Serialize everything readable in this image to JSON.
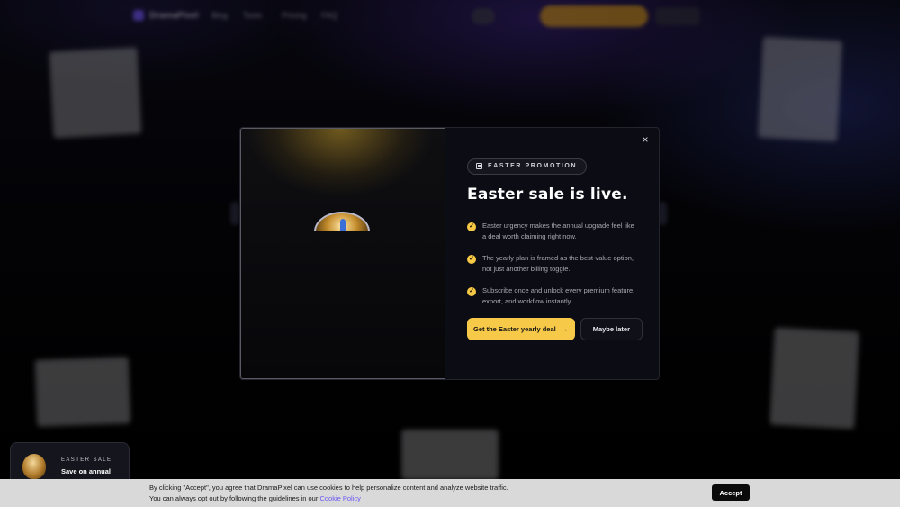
{
  "navbar": {
    "logo_text": "DramaPixel",
    "links": [
      "Blog",
      "Tools",
      "Pricing",
      "FAQ"
    ]
  },
  "modal": {
    "badge": "EASTER PROMOTION",
    "headline": "Easter sale is live.",
    "features": [
      "Easter urgency makes the annual upgrade feel like a deal worth claiming right now.",
      "The yearly plan is framed as the best-value option, not just another billing toggle.",
      "Subscribe once and unlock every premium feature, export, and workflow instantly."
    ],
    "primary_cta": "Get the Easter yearly deal",
    "secondary_cta": "Maybe later",
    "close_label": "×"
  },
  "promo_toast": {
    "kicker": "EASTER SALE",
    "title": "Save on annual"
  },
  "cookie_bar": {
    "line1": "By clicking \"Accept\", you agree that DramaPixel can use cookies to help personalize content and analyze website traffic.",
    "line2_prefix": "You can always opt out by following the guidelines in our ",
    "link_text": "Cookie Policy",
    "accept_label": "Accept"
  },
  "colors": {
    "accent_yellow": "#f7c948",
    "brand_purple": "#7a5cff",
    "link_purple": "#6a57f5"
  }
}
